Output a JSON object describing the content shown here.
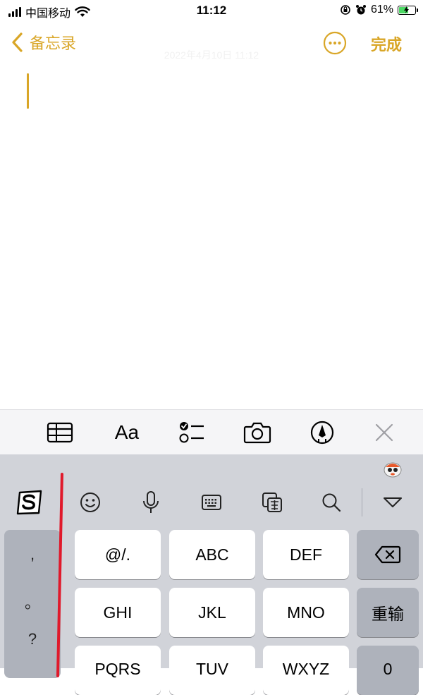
{
  "status_bar": {
    "carrier": "中国移动",
    "time": "11:12",
    "battery_percent": "61%",
    "battery_level": 0.61
  },
  "nav": {
    "back_label": "备忘录",
    "date_text": "2022年4月10日 11:12",
    "done_label": "完成"
  },
  "format_toolbar": {
    "text_style_label": "Aa",
    "tools": [
      "table-icon",
      "text-format",
      "checklist-icon",
      "camera-icon",
      "markup-pen-icon",
      "close-icon"
    ]
  },
  "ime_toolbar": {
    "tools": [
      "sogou-logo-icon",
      "emoji-icon",
      "microphone-icon",
      "keyboard-icon",
      "clipboard-translate-icon",
      "search-icon",
      "collapse-keyboard-icon"
    ]
  },
  "keyboard": {
    "punctuation": [
      ",",
      "。",
      "?"
    ],
    "keys_row1": [
      "@/.",
      "ABC",
      "DEF"
    ],
    "keys_row2": [
      "GHI",
      "JKL",
      "MNO"
    ],
    "keys_row3": [
      "PQRS",
      "TUV",
      "WXYZ"
    ],
    "retype_label": "重输",
    "zero_label": "0"
  },
  "colors": {
    "accent": "#d9a627",
    "keyboard_bg": "#d1d3d9",
    "key_bg": "#ffffff",
    "function_key_bg": "#aeb2bb",
    "annotation_line": "#e0192b"
  }
}
